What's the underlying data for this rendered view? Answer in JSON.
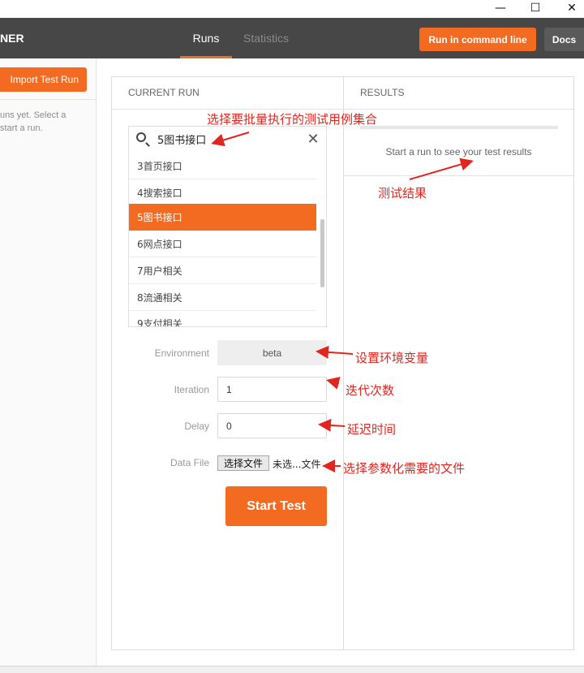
{
  "window": {
    "minimize_glyph": "—",
    "maximize_glyph": "☐",
    "close_glyph": "✕"
  },
  "header": {
    "brand": "NER",
    "tabs": [
      {
        "label": "Runs",
        "active": true
      },
      {
        "label": "Statistics",
        "active": false
      }
    ],
    "run_command_line": "Run in command line",
    "docs": "Docs"
  },
  "sidebar": {
    "import_button": "Import Test Run",
    "empty_text_line1": "uns yet. Select a",
    "empty_text_line2": "start a run."
  },
  "current_run": {
    "header": "CURRENT RUN",
    "search": {
      "value": "5图书接口",
      "icon": "search-icon"
    },
    "collections": [
      {
        "label": "3首页接口",
        "selected": false
      },
      {
        "label": "4搜索接口",
        "selected": false
      },
      {
        "label": "5图书接口",
        "selected": true
      },
      {
        "label": "6网点接口",
        "selected": false
      },
      {
        "label": "7用户相关",
        "selected": false
      },
      {
        "label": "8流通相关",
        "selected": false
      },
      {
        "label": "9支付相关",
        "selected": false
      }
    ],
    "environment": {
      "label": "Environment",
      "value": "beta"
    },
    "iteration": {
      "label": "Iteration",
      "value": "1"
    },
    "delay": {
      "label": "Delay",
      "value": "0"
    },
    "data_file": {
      "label": "Data File",
      "button": "选择文件",
      "status": "未选...文件"
    },
    "start_button": "Start Test"
  },
  "results": {
    "header": "RESULTS",
    "empty_message": "Start a run to see your test results"
  },
  "annotations": {
    "collection": "选择要批量执行的测试用例集合",
    "results": "测试结果",
    "environment": "设置环境变量",
    "iteration": "迭代次数",
    "delay": "延迟时间",
    "data_file": "选择参数化需要的文件"
  },
  "colors": {
    "accent": "#f26b21",
    "header_bg": "#474747",
    "annotation": "#e0261f"
  }
}
